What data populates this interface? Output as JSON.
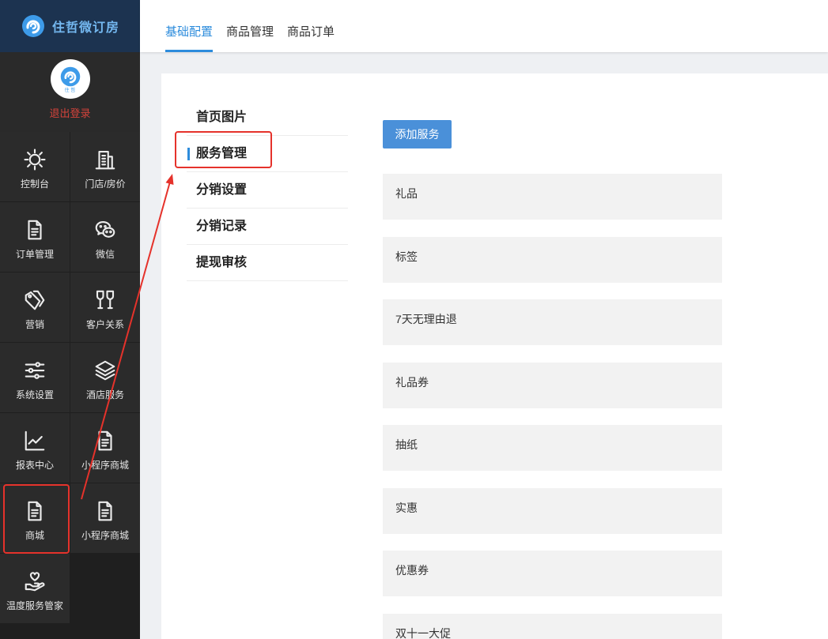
{
  "brand": {
    "name": "住哲微订房",
    "logo_icon": "zhuzhe-logo-icon"
  },
  "profile": {
    "avatar_logo_text": "住 哲",
    "logout_label": "退出登录"
  },
  "sidebar": {
    "items": [
      {
        "label": "控制台",
        "icon": "dashboard-sun-icon"
      },
      {
        "label": "门店/房价",
        "icon": "building-icon"
      },
      {
        "label": "订单管理",
        "icon": "document-icon"
      },
      {
        "label": "微信",
        "icon": "wechat-icon"
      },
      {
        "label": "营销",
        "icon": "tags-icon"
      },
      {
        "label": "客户关系",
        "icon": "wine-glasses-icon"
      },
      {
        "label": "系统设置",
        "icon": "sliders-icon"
      },
      {
        "label": "酒店服务",
        "icon": "layers-icon"
      },
      {
        "label": "报表中心",
        "icon": "line-chart-icon"
      },
      {
        "label": "小程序商城",
        "icon": "document-icon"
      },
      {
        "label": "商城",
        "icon": "document-icon",
        "annotated": true
      },
      {
        "label": "小程序商城",
        "icon": "document-icon"
      },
      {
        "label": "温度服务管家",
        "icon": "heart-hand-icon"
      }
    ]
  },
  "topbar": {
    "tabs": [
      {
        "label": "基础配置",
        "active": true
      },
      {
        "label": "商品管理",
        "active": false
      },
      {
        "label": "商品订单",
        "active": false
      }
    ]
  },
  "subnav": {
    "items": [
      {
        "label": "首页图片"
      },
      {
        "label": "服务管理",
        "active": true,
        "annotated": true
      },
      {
        "label": "分销设置"
      },
      {
        "label": "分销记录"
      },
      {
        "label": "提现审核"
      }
    ]
  },
  "services": {
    "add_button_label": "添加服务",
    "items": [
      "礼品",
      "标签",
      "7天无理由退",
      "礼品券",
      "抽纸",
      "实惠",
      "优惠券",
      "双十一大促"
    ]
  },
  "colors": {
    "accent": "#2d8cdc",
    "button": "#4a90d9",
    "sidebar": "#2b2b2b",
    "logo_bar": "#1c3350",
    "logout": "#d4433b",
    "annotation": "#e5322b",
    "service_row": "#f2f2f2"
  }
}
